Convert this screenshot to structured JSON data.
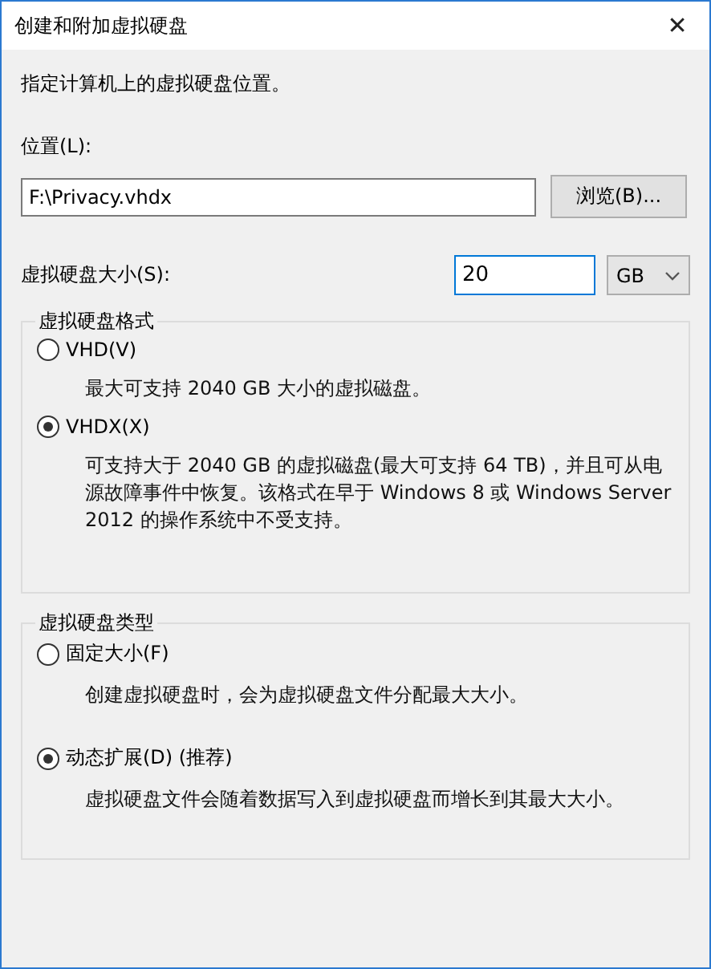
{
  "window": {
    "title": "创建和附加虚拟硬盘",
    "close": "✕"
  },
  "intro": "指定计算机上的虚拟硬盘位置。",
  "location": {
    "label": "位置(L):",
    "value": "F:\\Privacy.vhdx",
    "browse": "浏览(B)..."
  },
  "size": {
    "label": "虚拟硬盘大小(S):",
    "value": "20",
    "unit": "GB"
  },
  "groups": [
    {
      "title": "虚拟硬盘格式",
      "options": [
        {
          "label": "VHD(V)",
          "selected": false,
          "description": "最大可支持 2040 GB 大小的虚拟磁盘。"
        },
        {
          "label": "VHDX(X)",
          "selected": true,
          "description": "可支持大于 2040 GB 的虚拟磁盘(最大可支持 64 TB)，并且可从电源故障事件中恢复。该格式在早于 Windows 8 或 Windows Server 2012 的操作系统中不受支持。"
        }
      ]
    },
    {
      "title": "虚拟硬盘类型",
      "options": [
        {
          "label": "固定大小(F)",
          "selected": false,
          "description": "创建虚拟硬盘时，会为虚拟硬盘文件分配最大大小。"
        },
        {
          "label": "动态扩展(D) (推荐)",
          "selected": true,
          "description": "虚拟硬盘文件会随着数据写入到虚拟硬盘而增长到其最大大小。"
        }
      ]
    }
  ]
}
